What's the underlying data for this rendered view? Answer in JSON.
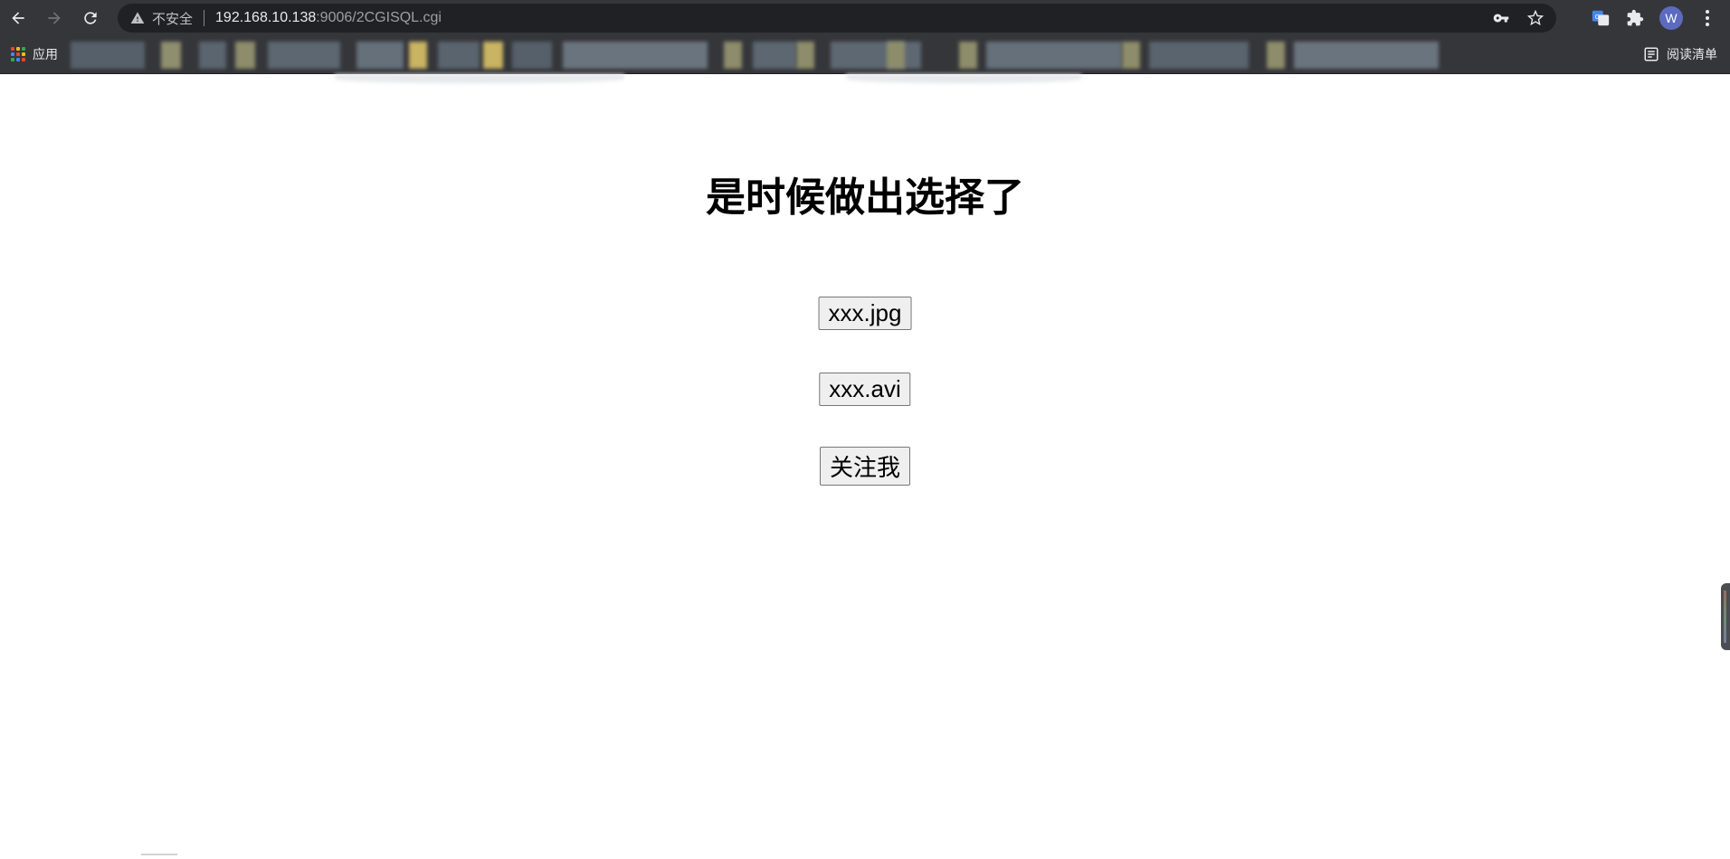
{
  "browser": {
    "security_label": "不安全",
    "url_host": "192.168.10.138",
    "url_path": ":9006/2CGISQL.cgi",
    "avatar_letter": "W"
  },
  "bookmarks": {
    "apps_label": "应用",
    "reading_list_label": "阅读清单"
  },
  "page": {
    "heading": "是时候做出选择了",
    "buttons": [
      {
        "label": "xxx.jpg"
      },
      {
        "label": "xxx.avi"
      },
      {
        "label": "关注我"
      }
    ]
  },
  "colors": {
    "toolbar_bg": "#35363a",
    "omnibox_bg": "#202124",
    "page_bg": "#ffffff",
    "button_bg": "#efefef"
  }
}
